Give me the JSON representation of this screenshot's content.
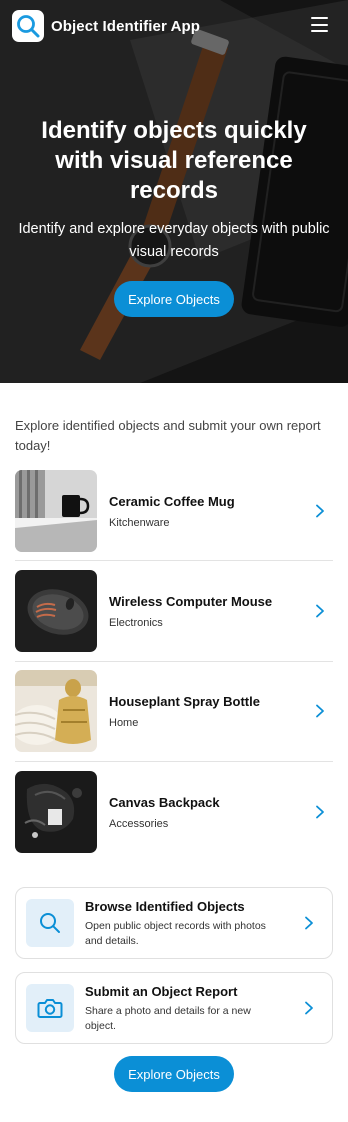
{
  "header": {
    "app_title": "Object Identifier App",
    "logo_icon": "search-icon",
    "menu_icon": "hamburger-menu-icon"
  },
  "hero": {
    "title": "Identify objects quickly with visual reference records",
    "subtitle": "Identify and explore everyday objects with public visual records",
    "cta_label": "Explore Objects",
    "accent_color": "#0b8fd6"
  },
  "intro": {
    "text": "Explore identified objects and submit your own report today!"
  },
  "objects": [
    {
      "name": "Ceramic Coffee Mug",
      "category": "Kitchenware"
    },
    {
      "name": "Wireless Computer Mouse",
      "category": "Electronics"
    },
    {
      "name": "Houseplant Spray Bottle",
      "category": "Home"
    },
    {
      "name": "Canvas Backpack",
      "category": "Accessories"
    }
  ],
  "actions": [
    {
      "title": "Browse Identified Objects",
      "description": "Open public object records with photos and details.",
      "icon": "search-icon"
    },
    {
      "title": "Submit an Object Report",
      "description": "Share a photo and details for a new object.",
      "icon": "camera-icon"
    }
  ],
  "footer": {
    "cta_label": "Explore Objects"
  }
}
